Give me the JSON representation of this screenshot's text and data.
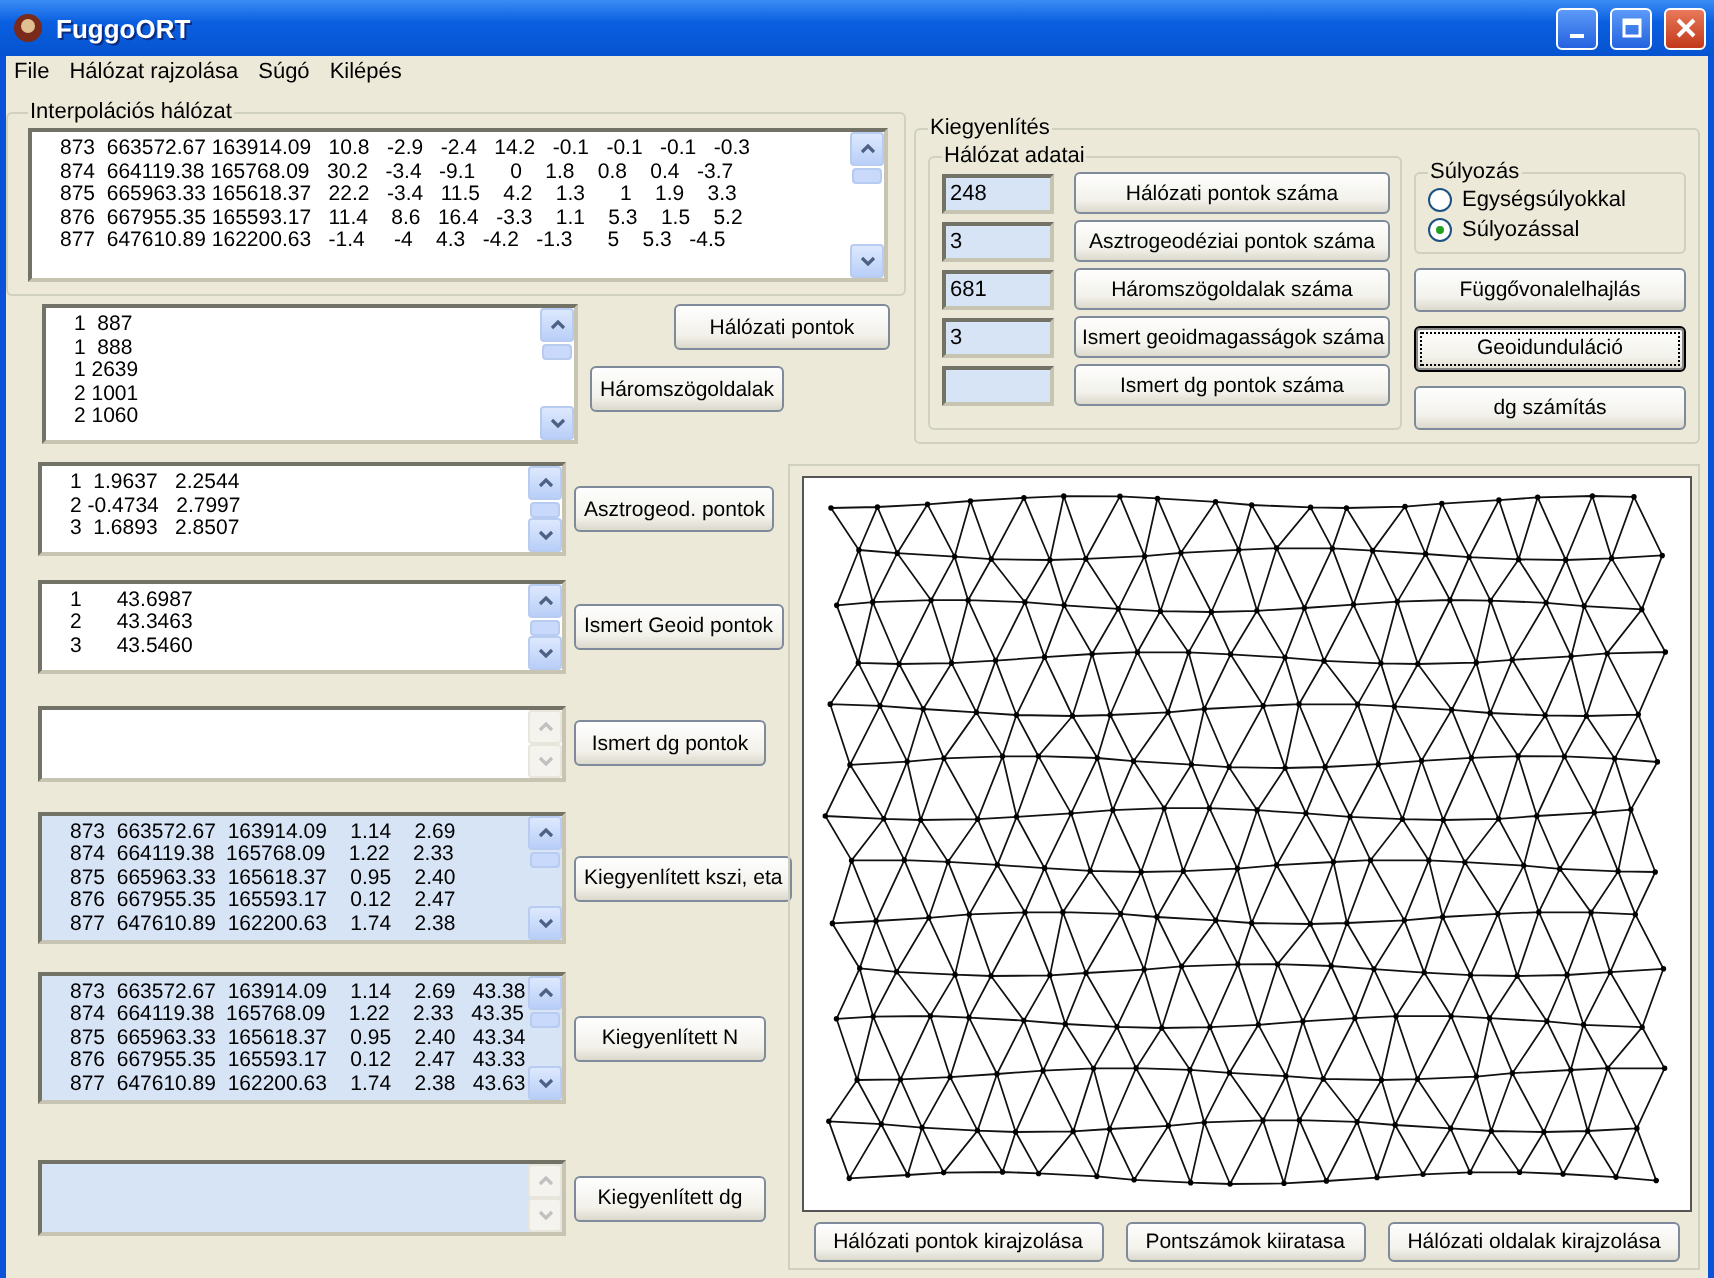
{
  "window": {
    "title": "FuggoORT"
  },
  "menu": [
    "File",
    "Hálózat rajzolása",
    "Súgó",
    "Kilépés"
  ],
  "interpolation": {
    "title": "Interpolációs hálózat",
    "lines": [
      "873  663572.67 163914.09   10.8   -2.9   -2.4   14.2   -0.1   -0.1   -0.1   -0.3",
      "874  664119.38 165768.09   30.2   -3.4   -9.1      0    1.8    0.8    0.4   -3.7",
      "875  665963.33 165618.37   22.2   -3.4   11.5    4.2    1.3      1    1.9    3.3",
      "876  667955.35 165593.17   11.4    8.6   16.4   -3.3    1.1    5.3    1.5    5.2",
      "877  647610.89 162200.63   -1.4     -4    4.3   -4.2   -1.3      5    5.3   -4.5"
    ]
  },
  "network_points_button": "Hálózati pontok",
  "lists": [
    {
      "kind": "input",
      "scrollable": true,
      "button": "Háromszögoldalak",
      "lines": [
        "1  887",
        "1  888",
        "1 2639",
        "2 1001",
        "2 1060"
      ]
    },
    {
      "kind": "input",
      "scrollable": true,
      "button": "Asztrogeod. pontok",
      "lines": [
        "1  1.9637   2.2544",
        "2 -0.4734   2.7997",
        "3  1.6893   2.8507"
      ]
    },
    {
      "kind": "input",
      "scrollable": true,
      "button": "Ismert Geoid pontok",
      "lines": [
        "1      43.6987",
        "2      43.3463",
        "3      43.5460"
      ]
    },
    {
      "kind": "input",
      "scrollable": false,
      "button": "Ismert dg pontok"
    },
    {
      "kind": "output",
      "scrollable": true,
      "button": "Kiegyenlített kszi, eta",
      "lines": [
        "873  663572.67  163914.09    1.14    2.69",
        "874  664119.38  165768.09    1.22    2.33",
        "875  665963.33  165618.37    0.95    2.40",
        "876  667955.35  165593.17    0.12    2.47",
        "877  647610.89  162200.63    1.74    2.38"
      ]
    },
    {
      "kind": "output",
      "scrollable": true,
      "button": "Kiegyenlített N",
      "lines": [
        "873  663572.67  163914.09    1.14    2.69   43.38",
        "874  664119.38  165768.09    1.22    2.33   43.35",
        "875  665963.33  165618.37    0.95    2.40   43.34",
        "876  667955.35  165593.17    0.12    2.47   43.33",
        "877  647610.89  162200.63    1.74    2.38   43.63"
      ]
    },
    {
      "kind": "output",
      "scrollable": false,
      "button": "Kiegyenlített dg"
    }
  ],
  "adjustment": {
    "title": "Kiegyenlítés",
    "network_data": {
      "title": "Hálózat adatai",
      "rows": [
        {
          "value": "248",
          "button": "Hálózati pontok száma"
        },
        {
          "value": "3",
          "button": "Asztrogeodéziai pontok száma"
        },
        {
          "value": "681",
          "button": "Háromszögoldalak száma"
        },
        {
          "value": "3",
          "button": "Ismert geoidmagasságok száma"
        },
        {
          "value": "",
          "button": "Ismert dg pontok száma"
        }
      ]
    },
    "weighting": {
      "title": "Súlyozás",
      "options": [
        {
          "label": "Egységsúlyokkal",
          "selected": false
        },
        {
          "label": "Súlyozással",
          "selected": true
        }
      ]
    },
    "buttons": [
      {
        "label": "Függővonalelhajlás",
        "focused": false
      },
      {
        "label": "Geoidunduláció",
        "focused": true
      },
      {
        "label": "dg számítás",
        "focused": false
      }
    ]
  },
  "drawing_buttons": [
    "Hálózati pontok kirajzolása",
    "Pontszámok kiiratasa",
    "Hálózati oldalak kirajzolása"
  ]
}
